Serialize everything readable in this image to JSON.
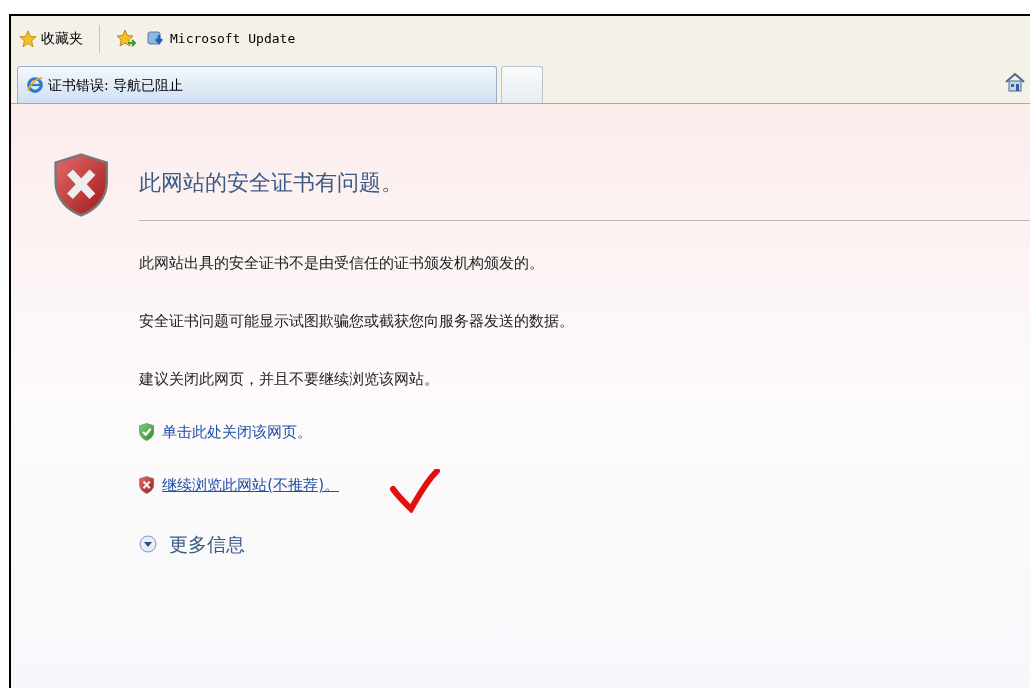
{
  "favorites_bar": {
    "favorites_label": "收藏夹",
    "links": [
      "Microsoft Update"
    ]
  },
  "tabs": [
    {
      "title": "证书错误: 导航已阻止",
      "selected": true
    },
    {
      "selected": false
    }
  ],
  "page": {
    "heading": "此网站的安全证书有问题。",
    "paragraphs": [
      "此网站出具的安全证书不是由受信任的证书颁发机构颁发的。",
      "安全证书问题可能显示试图欺骗您或截获您向服务器发送的数据。",
      "建议关闭此网页，并且不要继续浏览该网站。"
    ],
    "actions": [
      {
        "kind": "safe",
        "label": "单击此处关闭该网页。",
        "underlined": false
      },
      {
        "kind": "unsafe",
        "label": "继续浏览此网站(不推荐)。",
        "underlined": true
      }
    ],
    "more_info": {
      "label": "更多信息",
      "expanded": false
    }
  }
}
